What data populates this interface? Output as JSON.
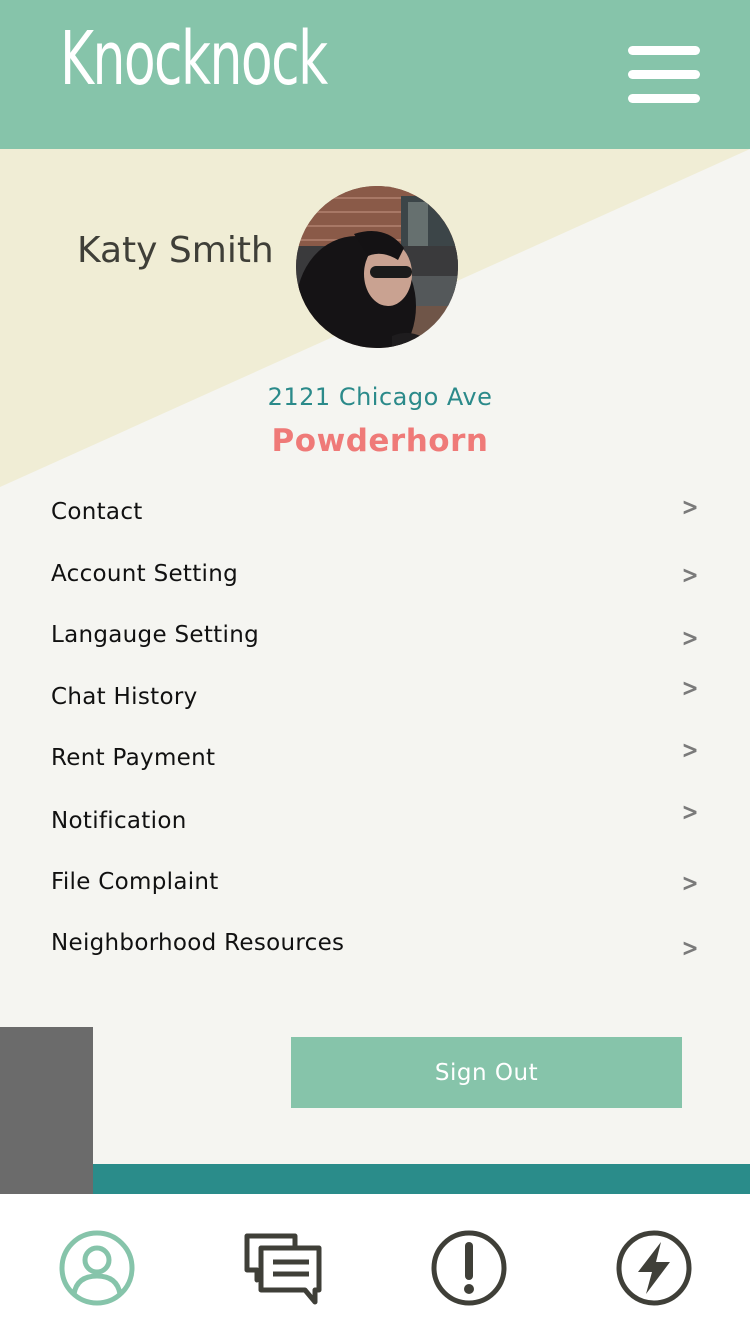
{
  "app": {
    "title": "Knocknock"
  },
  "profile": {
    "name": "Katy Smith",
    "address": "2121 Chicago Ave",
    "neighborhood": "Powderhorn"
  },
  "menu": [
    {
      "label": "Contact",
      "chevron": ">"
    },
    {
      "label": "Account Setting",
      "chevron": ">"
    },
    {
      "label": "Langauge Setting",
      "chevron": ">"
    },
    {
      "label": "Chat History",
      "chevron": ">"
    },
    {
      "label": "Rent Payment",
      "chevron": ">"
    },
    {
      "label": "Notification",
      "chevron": ">"
    },
    {
      "label": "File Complaint",
      "chevron": ">"
    },
    {
      "label": "Neighborhood Resources",
      "chevron": ">"
    }
  ],
  "actions": {
    "sign_out": "Sign Out"
  },
  "tabs": [
    {
      "icon": "profile-icon",
      "active": true
    },
    {
      "icon": "chat-icon",
      "active": false
    },
    {
      "icon": "alert-icon",
      "active": false
    },
    {
      "icon": "lightning-icon",
      "active": false
    }
  ],
  "colors": {
    "header": "#86c4aa",
    "accent_teal": "#2a8c8a",
    "neighborhood": "#ef7a78",
    "background": "#f5f5f1",
    "diagonal": "#f0edd5"
  }
}
